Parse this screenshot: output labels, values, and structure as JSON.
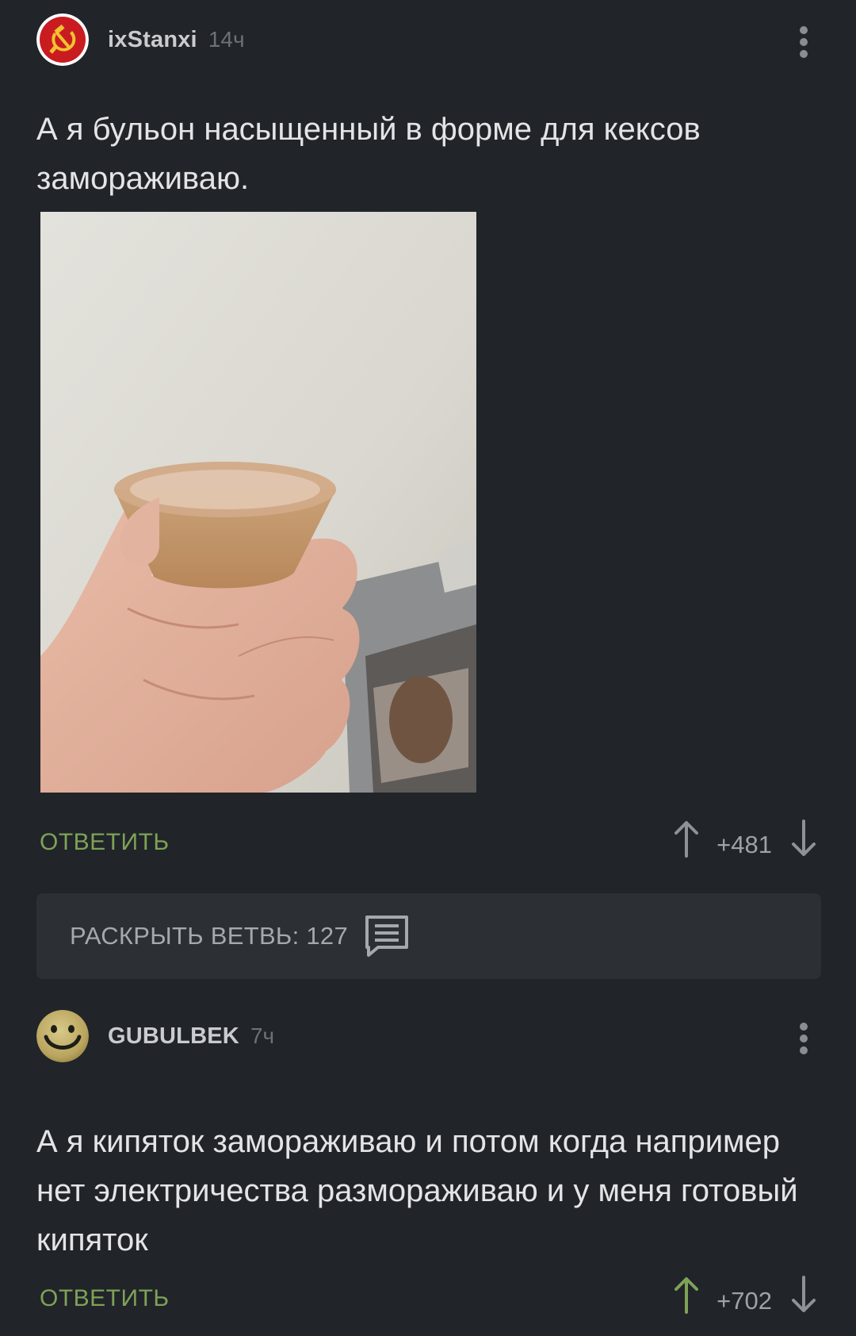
{
  "comments": [
    {
      "username": "ixStanxi",
      "time": "14ч",
      "text": "А я бульон насыщенный в форме для кексов замораживаю.",
      "avatar": "hammer-sickle-icon",
      "reply_label": "ОТВЕТИТЬ",
      "rating": "+481"
    },
    {
      "username": "GUBULBEK",
      "time": "7ч",
      "text": "А я кипяток замораживаю и потом когда например нет электричества размораживаю и у меня готовый кипяток",
      "avatar": "smiley-face-icon",
      "reply_label": "ОТВЕТИТЬ",
      "rating": "+702",
      "upvoted": true
    }
  ],
  "thread": {
    "expand_label": "РАСКРЫТЬ ВЕТВЬ: 127",
    "icon": "comments-icon"
  },
  "colors": {
    "background": "#212429",
    "accent_green": "#7ea257",
    "avatar_red": "#c91c20",
    "avatar_gold": "#f2c230"
  }
}
